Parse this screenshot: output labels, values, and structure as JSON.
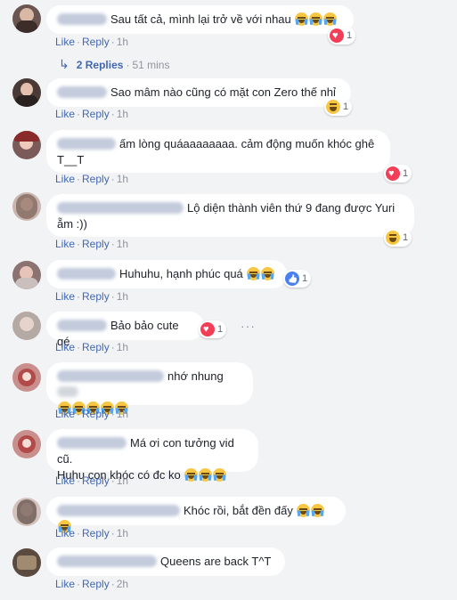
{
  "actions": {
    "like": "Like",
    "reply": "Reply",
    "sep": "·"
  },
  "comments": [
    {
      "text": "Sau tất cả, mình lại trở về với nhau",
      "time": "1h",
      "reaction": "love",
      "count": "1"
    },
    {
      "text": "Sao mâm nào cũng có mặt con Zero thế nhỉ",
      "time": "1h",
      "reaction": "haha",
      "count": "1"
    },
    {
      "text": "ấm lòng quáaaaaaaaa. cảm động muốn khóc ghê",
      "text2": "T__T",
      "time": "1h",
      "reaction": "love",
      "count": "1"
    },
    {
      "text": "Lộ diện thành viên thứ 9 đang được Yuri",
      "text2": "ẵm :))",
      "time": "1h",
      "reaction": "haha",
      "count": "1"
    },
    {
      "text": "Huhuhu, hạnh phúc quá",
      "time": "1h",
      "reaction": "like",
      "count": "1"
    },
    {
      "text": "Bảo bảo cute qé",
      "time": "1h",
      "reaction": "love",
      "count": "1"
    },
    {
      "text": "nhớ nhung",
      "time": "1h"
    },
    {
      "text": "Má ơi con tưởng vid cũ.",
      "text2": "Huhu con khóc có đc ko",
      "time": "1h"
    },
    {
      "text": "Khóc rồi, bắt đền đấy",
      "time": "1h"
    },
    {
      "text": "Queens are back T^T",
      "time": "2h"
    }
  ],
  "replies": {
    "label": "2 Replies",
    "time": "51 mins"
  },
  "more": "···",
  "icons": {
    "like_color": "#4a7ff0",
    "love_color": "#f33e58",
    "haha_color": "#f7c744",
    "link_color": "#4267b2"
  }
}
